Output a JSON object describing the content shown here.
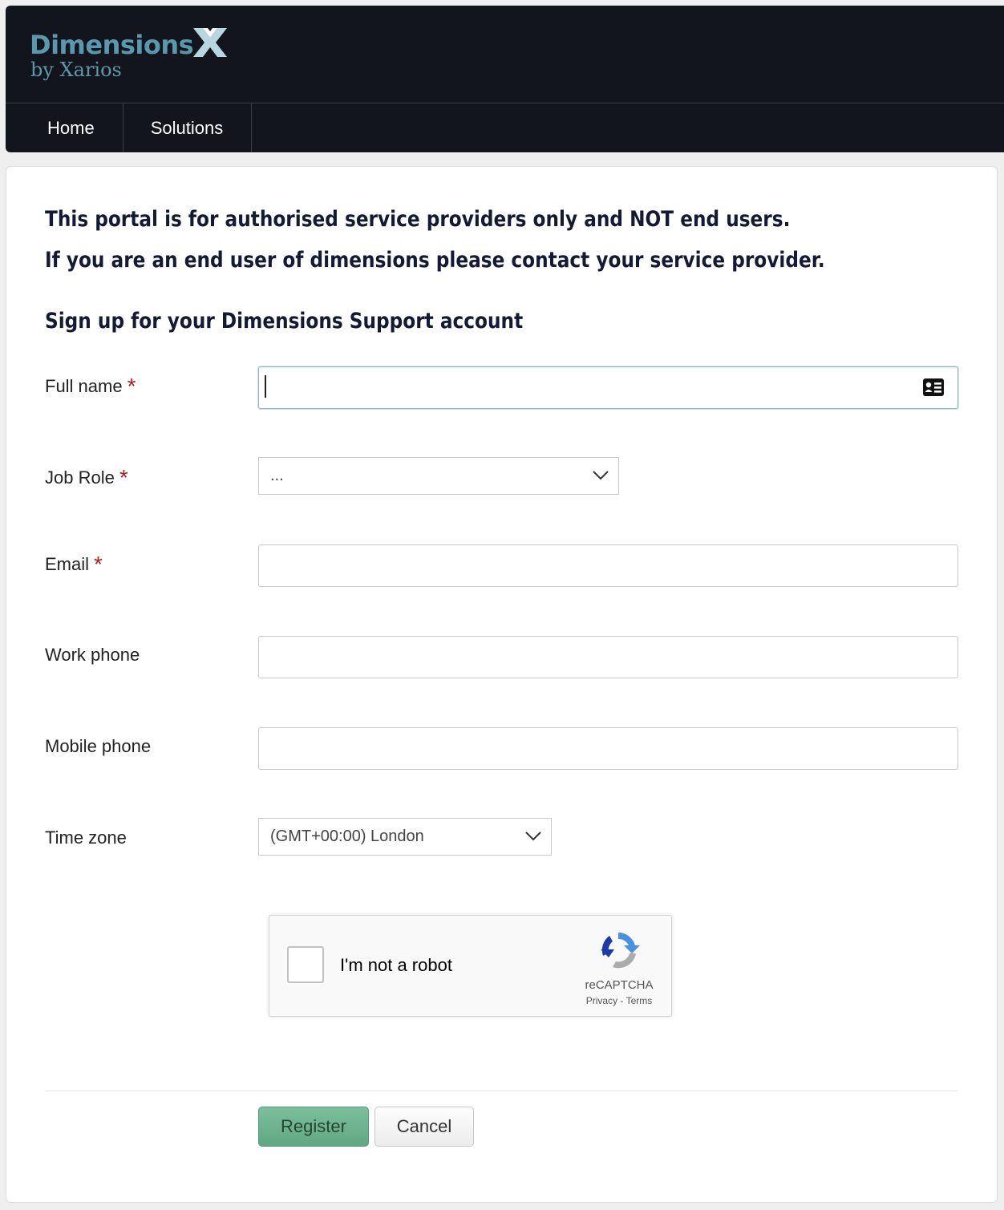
{
  "brand": {
    "name": "Dimensions",
    "sub": "by Xarios",
    "color": "#5a98ad"
  },
  "nav": {
    "items": [
      {
        "label": "Home"
      },
      {
        "label": "Solutions"
      }
    ]
  },
  "notice": {
    "line1": "This portal is for authorised service providers only and NOT end users.",
    "line2": "If you are an end user of dimensions please contact your service provider."
  },
  "form": {
    "title": "Sign up for your Dimensions Support account",
    "full_name": {
      "label": "Full name",
      "required": "*",
      "value": "",
      "icon": "contact-card-icon"
    },
    "job_role": {
      "label": "Job Role",
      "required": "*",
      "selected": "..."
    },
    "email": {
      "label": "Email",
      "required": "*",
      "value": ""
    },
    "work_phone": {
      "label": "Work phone",
      "value": ""
    },
    "mobile_phone": {
      "label": "Mobile phone",
      "value": ""
    },
    "time_zone": {
      "label": "Time zone",
      "selected": "(GMT+00:00) London"
    }
  },
  "recaptcha": {
    "label": "I'm not a robot",
    "brand": "reCAPTCHA",
    "privacy": "Privacy",
    "separator": "-",
    "terms": "Terms"
  },
  "actions": {
    "register": "Register",
    "cancel": "Cancel",
    "register_color": "#6db38e"
  }
}
